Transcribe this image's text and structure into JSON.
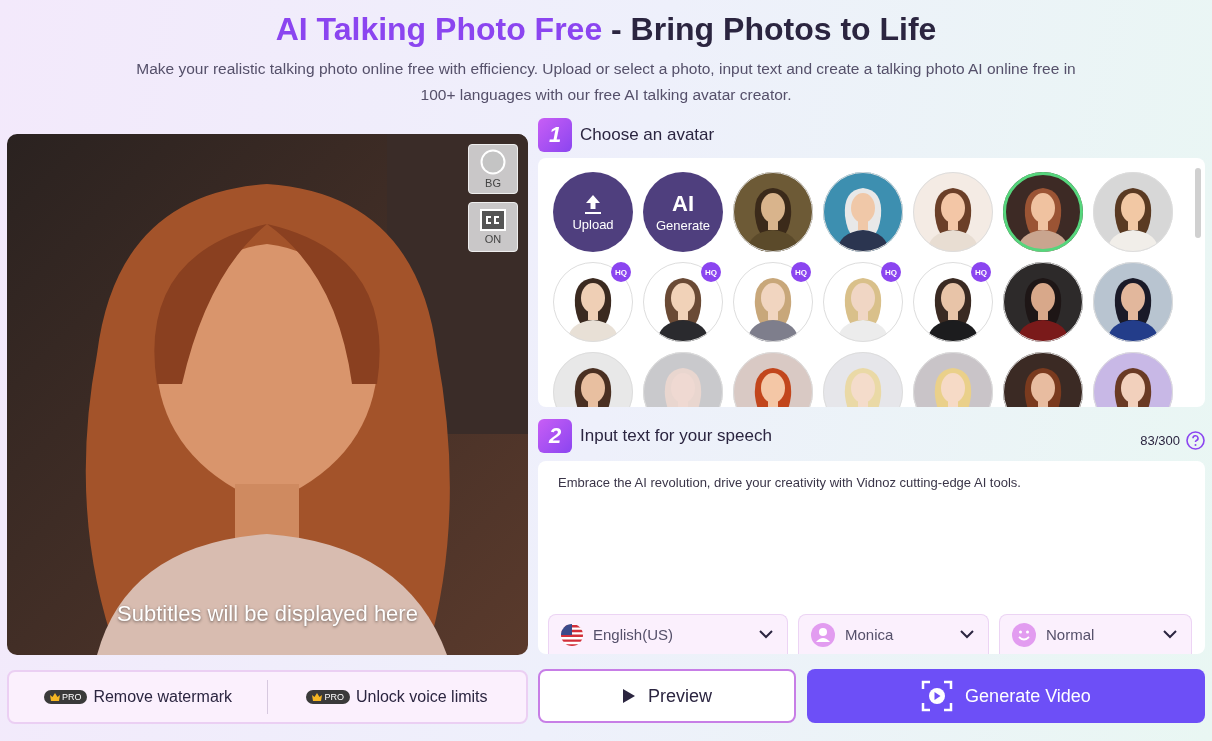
{
  "header": {
    "title_highlight": "AI Talking Photo Free",
    "title_rest": "- Bring Photos to Life",
    "description": "Make your realistic talking photo online free with efficiency. Upload or select a photo, input text and create a talking photo AI online free in 100+ languages with our free AI talking avatar creator."
  },
  "preview": {
    "kind": "picture",
    "subtitle": "Subtitles will be displayed here",
    "controls": [
      {
        "kind": "bg",
        "label": "BG"
      },
      {
        "kind": "cc",
        "label": "ON"
      }
    ]
  },
  "step1": {
    "number": "1",
    "title": "Choose an avatar",
    "avatars": [
      {
        "kind": "upload",
        "label": "Upload"
      },
      {
        "kind": "generate",
        "icon_text": "AI",
        "label": "Generate"
      },
      {
        "kind": "picture",
        "selected": false
      },
      {
        "kind": "picture",
        "selected": false
      },
      {
        "kind": "picture",
        "selected": false
      },
      {
        "kind": "picture",
        "selected": true
      },
      {
        "kind": "picture",
        "selected": false
      },
      {
        "kind": "picture",
        "selected": false,
        "badge": "HQ"
      },
      {
        "kind": "picture",
        "selected": false,
        "badge": "HQ"
      },
      {
        "kind": "picture",
        "selected": false,
        "badge": "HQ"
      },
      {
        "kind": "picture",
        "selected": false,
        "badge": "HQ"
      },
      {
        "kind": "picture",
        "selected": false,
        "badge": "HQ"
      },
      {
        "kind": "picture",
        "selected": false
      },
      {
        "kind": "picture",
        "selected": false
      },
      {
        "kind": "picture",
        "selected": false
      },
      {
        "kind": "picture",
        "selected": false
      },
      {
        "kind": "picture",
        "selected": false
      },
      {
        "kind": "picture",
        "selected": false
      },
      {
        "kind": "picture",
        "selected": false
      },
      {
        "kind": "picture",
        "selected": false
      },
      {
        "kind": "picture",
        "selected": false
      }
    ]
  },
  "step2": {
    "number": "2",
    "title": "Input text for your speech",
    "counter": "83/300",
    "text": "Embrace the AI revolution, drive your creativity with Vidnoz cutting-edge AI tools.",
    "selectors": [
      {
        "kind": "language",
        "value": "English(US)"
      },
      {
        "kind": "voice",
        "value": "Monica"
      },
      {
        "kind": "emotion",
        "value": "Normal"
      }
    ]
  },
  "actions": {
    "pro_features": [
      {
        "badge": "PRO",
        "label": "Remove watermark"
      },
      {
        "badge": "PRO",
        "label": "Unlock voice limits"
      }
    ],
    "preview_button": "Preview",
    "generate_button": "Generate Video"
  }
}
